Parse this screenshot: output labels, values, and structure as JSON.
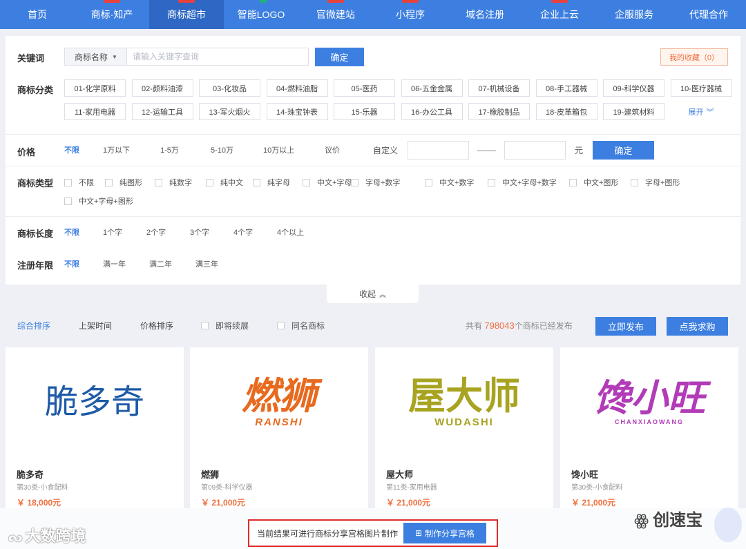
{
  "nav": {
    "items": [
      {
        "label": "首页",
        "badge": false
      },
      {
        "label": "商标·知产",
        "badge": true
      },
      {
        "label": "商标超市",
        "badge": true,
        "active": true
      },
      {
        "label": "智能LOGO",
        "badge": true,
        "badge_green": true
      },
      {
        "label": "官微建站",
        "badge": true
      },
      {
        "label": "小程序",
        "badge": true
      },
      {
        "label": "域名注册",
        "badge": false
      },
      {
        "label": "企业上云",
        "badge": true
      },
      {
        "label": "企服服务",
        "badge": false
      },
      {
        "label": "代理合作",
        "badge": false
      }
    ]
  },
  "keyword": {
    "label": "关键词",
    "select_value": "商标名称",
    "placeholder": "请输入关键字查询",
    "confirm": "确定",
    "favorites": "我的收藏（0）"
  },
  "categories": {
    "label": "商标分类",
    "items": [
      "01-化学原料",
      "02-颜料油漆",
      "03-化妆品",
      "04-燃料油脂",
      "05-医药",
      "06-五金金属",
      "07-机械设备",
      "08-手工器械",
      "09-科学仪器",
      "10-医疗器械",
      "11-家用电器",
      "12-运输工具",
      "13-军火烟火",
      "14-珠宝钟表",
      "15-乐器",
      "16-办公工具",
      "17-橡胶制品",
      "18-皮革箱包",
      "19-建筑材料"
    ],
    "more": "展开"
  },
  "price": {
    "label": "价格",
    "options": [
      "不限",
      "1万以下",
      "1-5万",
      "5-10万",
      "10万以上",
      "议价"
    ],
    "custom_label": "自定义",
    "unit": "元",
    "confirm": "确定"
  },
  "type": {
    "label": "商标类型",
    "row1": [
      "不限",
      "纯图形",
      "纯数字",
      "纯中文",
      "纯字母",
      "中文+字母",
      "字母+数字",
      "中文+数字",
      "中文+字母+数字",
      "中文+图形",
      "字母+图形"
    ],
    "row2": [
      "中文+字母+图形"
    ]
  },
  "length": {
    "label": "商标长度",
    "options": [
      "不限",
      "1个字",
      "2个字",
      "3个字",
      "4个字",
      "4个以上"
    ]
  },
  "years": {
    "label": "注册年限",
    "options": [
      "不限",
      "满一年",
      "满二年",
      "满三年"
    ]
  },
  "collapse": "收起",
  "sort": {
    "items": [
      "综合排序",
      "上架时间",
      "价格排序"
    ],
    "checks": [
      "即将续展",
      "同名商标"
    ],
    "count_prefix": "共有",
    "count": "798043",
    "count_suffix": "个商标已经发布",
    "publish": "立即发布",
    "request": "点我求购"
  },
  "cards": [
    {
      "logo_text": "脆多奇",
      "logo_sub": "",
      "name": "脆多奇",
      "class": "第30类-小食配料",
      "price": "￥ 18,000元",
      "color": "#1d5aa8"
    },
    {
      "logo_text": "燃狮",
      "logo_sub": "RANSHI",
      "name": "燃狮",
      "class": "第09类-科学仪器",
      "price": "￥ 21,000元",
      "color": "#e86a1e"
    },
    {
      "logo_text": "屋大师",
      "logo_sub": "WUDASHI",
      "name": "屋大师",
      "class": "第11类-家用电器",
      "price": "￥ 21,000元",
      "color": "#a8a320"
    },
    {
      "logo_text": "馋小旺",
      "logo_sub": "CHANXIAOWANG",
      "name": "馋小旺",
      "class": "第30类-小食配料",
      "price": "￥ 21,000元",
      "color": "#b23bb8"
    }
  ],
  "notice": {
    "text": "当前结果可进行商标分享宫格图片制作",
    "button": "制作分享宫格"
  },
  "watermarks": {
    "left": "大数跨境",
    "right": "创速宝"
  }
}
